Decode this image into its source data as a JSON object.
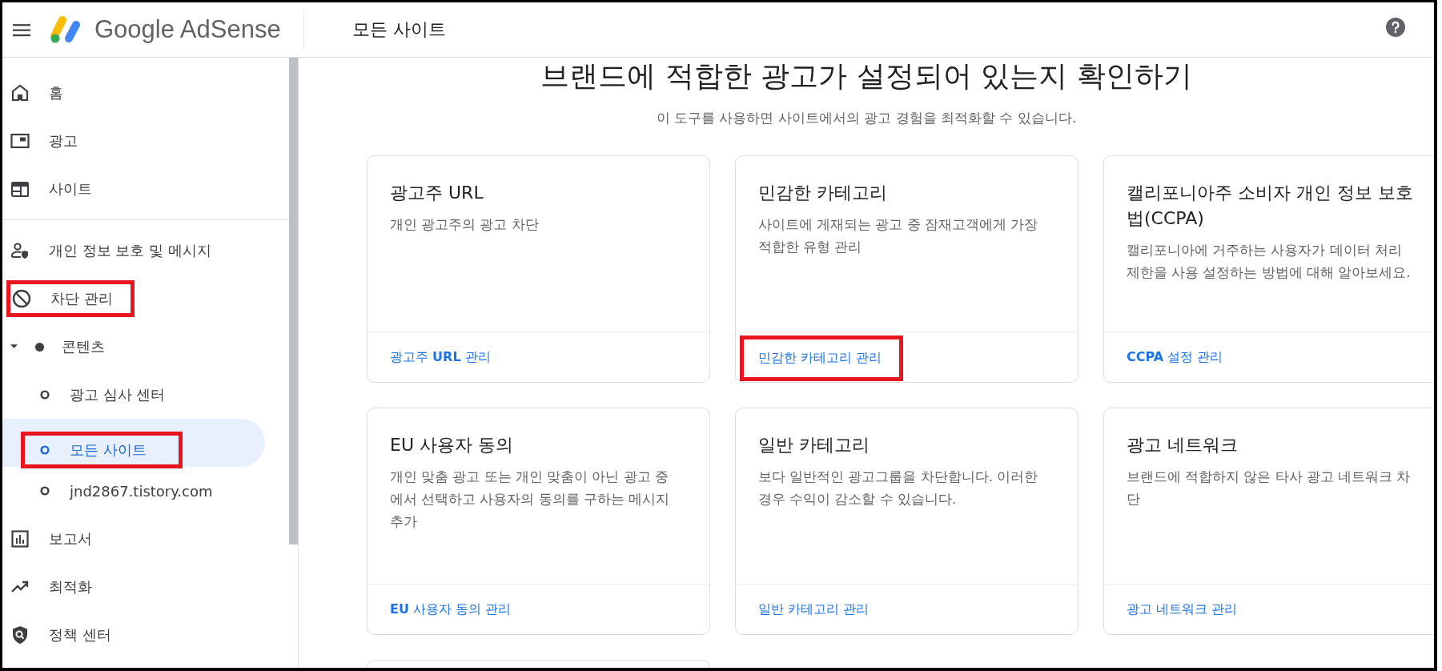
{
  "app": {
    "product": "Google AdSense",
    "page_title": "모든 사이트"
  },
  "sidebar": {
    "items": [
      {
        "kind": "main",
        "label": "홈",
        "selected": false,
        "annotated": false
      },
      {
        "kind": "main",
        "label": "광고",
        "selected": false,
        "annotated": false
      },
      {
        "kind": "main",
        "label": "사이트",
        "selected": false,
        "annotated": false
      },
      {
        "kind": "divider"
      },
      {
        "kind": "main",
        "label": "개인 정보 보호 및 메시지",
        "selected": false,
        "annotated": false
      },
      {
        "kind": "main",
        "label": "차단 관리",
        "selected": false,
        "annotated": true
      },
      {
        "kind": "group",
        "label": "콘텐츠",
        "expanded": true,
        "selected": false,
        "children": [
          {
            "label": "광고 심사 센터",
            "selected": false,
            "annotated": false
          },
          {
            "label": "모든 사이트",
            "selected": true,
            "annotated": true
          },
          {
            "label": "jnd2867.tistory.com",
            "selected": false,
            "annotated": false
          }
        ]
      },
      {
        "kind": "main",
        "label": "보고서",
        "selected": false,
        "annotated": false
      },
      {
        "kind": "main",
        "label": "최적화",
        "selected": false,
        "annotated": false
      },
      {
        "kind": "main",
        "label": "정책 센터",
        "selected": false,
        "annotated": false
      }
    ]
  },
  "main": {
    "heading": "브랜드에 적합한 광고가 설정되어 있는지 확인하기",
    "subtitle": "이 도구를 사용하면 사이트에서의 광고 경험을 최적화할 수 있습니다.",
    "cards": [
      {
        "kind": "full",
        "title": "광고주 URL",
        "description": "개인 광고주의 광고 차단",
        "link": "광고주 **URL** 관리",
        "annotated": false
      },
      {
        "kind": "full",
        "title": "민감한 카테고리",
        "description": "사이트에 게재되는 광고 중 잠재고객에게 가장 적합한 유형 관리",
        "link": "민감한 카테고리 관리",
        "annotated": true
      },
      {
        "kind": "full",
        "title": "캘리포니아주 소비자 개인 정보 보호법(CCPA)",
        "description": "캘리포니아에 거주하는 사용자가 데이터 처리 제한을 사용 설정하는 방법에 대해 알아보세요.",
        "link": "**CCPA** 설정 관리",
        "annotated": false
      },
      {
        "kind": "full",
        "title": "EU 사용자 동의",
        "description": "개인 맞춤 광고 또는 개인 맞춤이 아닌 광고 중에서 선택하고 사용자의 동의를 구하는 메시지 추가",
        "link": "**EU** 사용자 동의 관리",
        "annotated": false
      },
      {
        "kind": "full",
        "title": "일반 카테고리",
        "description": "보다 일반적인 광고그룹을 차단합니다. 이러한 경우 수익이 감소할 수 있습니다.",
        "link": "일반 카테고리 관리",
        "annotated": false
      },
      {
        "kind": "full",
        "title": "광고 네트워크",
        "description": "브랜드에 적합하지 않은 타사 광고 네트워크 차단",
        "link": "광고 네트워크 관리",
        "annotated": false
      },
      {
        "kind": "partial"
      }
    ]
  }
}
